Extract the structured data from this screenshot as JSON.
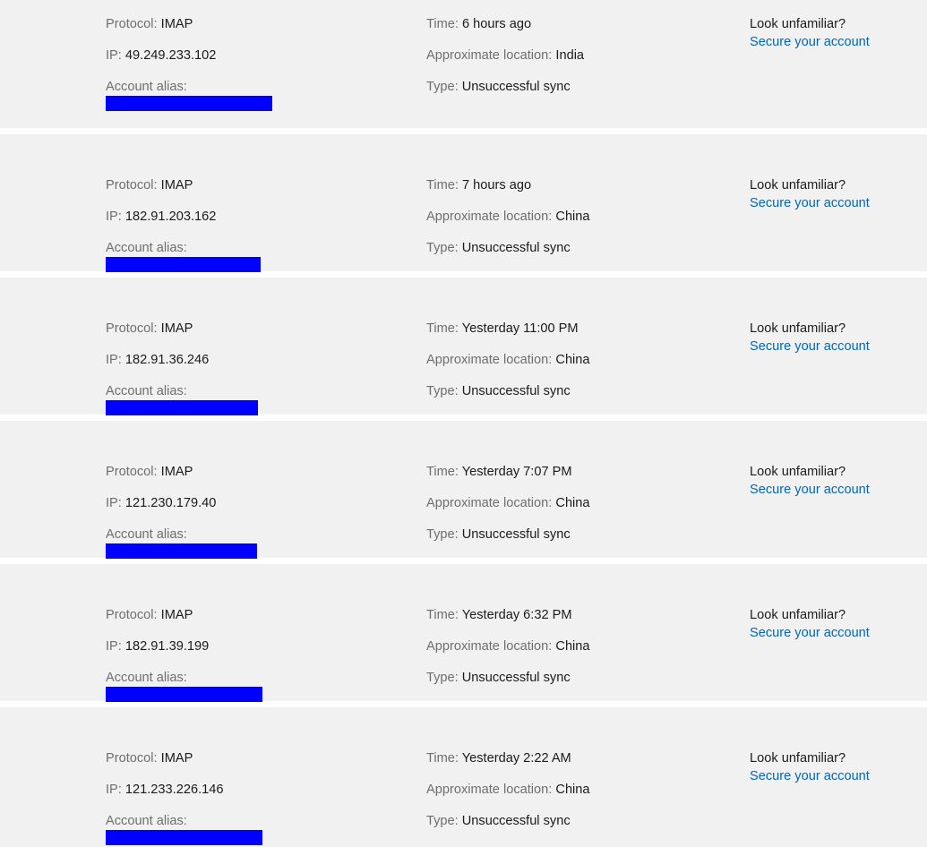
{
  "labels": {
    "protocol": "Protocol:",
    "ip": "IP:",
    "account_alias": "Account alias:",
    "time": "Time:",
    "approximate_location": "Approximate location:",
    "type": "Type:",
    "look_unfamiliar": "Look unfamiliar?",
    "secure_your_account": "Secure your account"
  },
  "colors": {
    "row_background": "#f1f1f1",
    "page_background": "#ffffff",
    "label_text": "#6e6e6e",
    "value_text": "#1b1b1b",
    "link": "#0067b8",
    "redaction": "#0000ff"
  },
  "sessions": [
    {
      "protocol": "IMAP",
      "ip": "49.249.233.102",
      "account_alias": "",
      "alias_redacted": true,
      "redaction_width": 186,
      "time": "6 hours ago",
      "approximate_location": "India",
      "type": "Unsuccessful sync"
    },
    {
      "protocol": "IMAP",
      "ip": "182.91.203.162",
      "account_alias": "",
      "alias_redacted": true,
      "redaction_width": 173,
      "time": "7 hours ago",
      "approximate_location": "China",
      "type": "Unsuccessful sync"
    },
    {
      "protocol": "IMAP",
      "ip": "182.91.36.246",
      "account_alias": "",
      "alias_redacted": true,
      "redaction_width": 170,
      "time": "Yesterday 11:00 PM",
      "approximate_location": "China",
      "type": "Unsuccessful sync"
    },
    {
      "protocol": "IMAP",
      "ip": "121.230.179.40",
      "account_alias": "",
      "alias_redacted": true,
      "redaction_width": 169,
      "time": "Yesterday 7:07 PM",
      "approximate_location": "China",
      "type": "Unsuccessful sync"
    },
    {
      "protocol": "IMAP",
      "ip": "182.91.39.199",
      "account_alias": "",
      "alias_redacted": true,
      "redaction_width": 175,
      "time": "Yesterday 6:32 PM",
      "approximate_location": "China",
      "type": "Unsuccessful sync"
    },
    {
      "protocol": "IMAP",
      "ip": "121.233.226.146",
      "account_alias": "",
      "alias_redacted": true,
      "redaction_width": 175,
      "time": "Yesterday 2:22 AM",
      "approximate_location": "China",
      "type": "Unsuccessful sync"
    }
  ]
}
